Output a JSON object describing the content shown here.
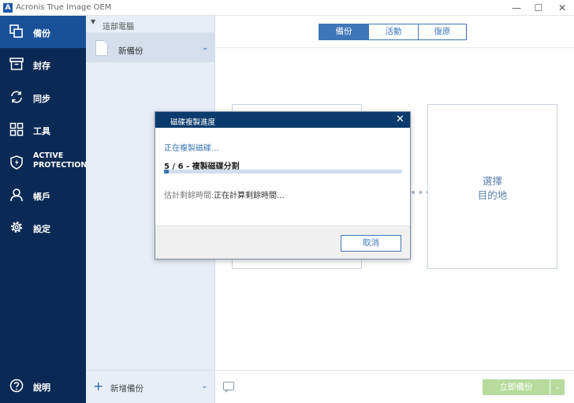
{
  "titlebar": {
    "app_icon_letter": "A",
    "title": "Acronis True Image OEM",
    "minimize": "—",
    "maximize": "☐",
    "close": "✕"
  },
  "sidebar": {
    "items": [
      {
        "label": "備份",
        "icon": "copy-icon",
        "active": true
      },
      {
        "label": "封存",
        "icon": "archive-icon"
      },
      {
        "label": "同步",
        "icon": "sync-icon"
      },
      {
        "label": "工具",
        "icon": "grid-icon"
      },
      {
        "label_line1": "ACTIVE",
        "label_line2": "PROTECTION",
        "icon": "shield-icon"
      },
      {
        "label": "帳戶",
        "icon": "user-icon"
      },
      {
        "label": "設定",
        "icon": "gear-icon"
      }
    ],
    "help": {
      "label": "說明",
      "icon": "help-icon"
    }
  },
  "backup_list": {
    "group_label": "這部電腦",
    "item_name": "新備份",
    "add_label": "新增備份"
  },
  "main": {
    "tabs": [
      {
        "label": "備份",
        "active": true
      },
      {
        "label": "活動"
      },
      {
        "label": "復原"
      }
    ],
    "dest_line1": "選擇",
    "dest_line2": "目的地",
    "dots": "•••",
    "backup_now_label": "立即備份",
    "backup_now_dropdown": "⌄"
  },
  "dialog": {
    "title": "磁碟複製進度",
    "close": "✕",
    "status": "正在複製磁碟...",
    "step": "5 / 6 - 複製磁碟分割",
    "progress_fraction": 0.02,
    "time_label": "估計剩餘時間:",
    "time_value": "正在計算剩餘時間...",
    "cancel_label": "取消"
  },
  "colors": {
    "sidebar_bg": "#0a2a55",
    "sidebar_active": "#1a5098",
    "accent": "#3e76b7",
    "dialog_title_bg": "#0b3b6d",
    "backup_now_bg": "#b6db9c"
  }
}
